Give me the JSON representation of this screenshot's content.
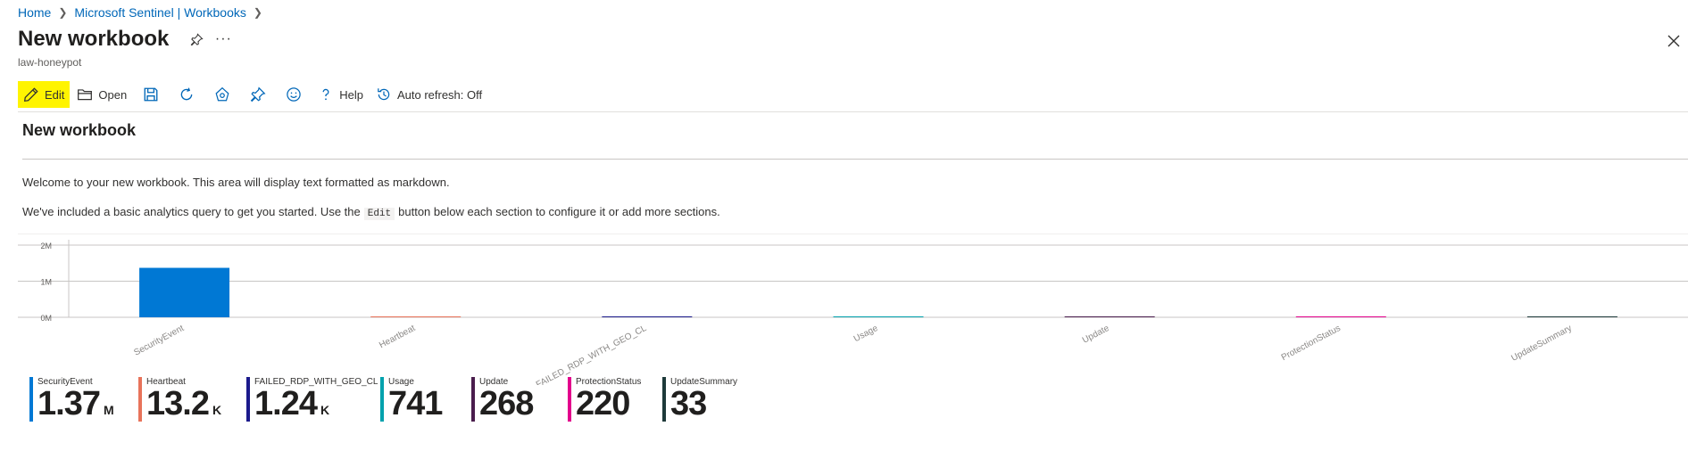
{
  "breadcrumb": {
    "home": "Home",
    "workbooks": "Microsoft Sentinel | Workbooks"
  },
  "header": {
    "title": "New workbook",
    "subtitle": "law-honeypot",
    "more": "···"
  },
  "toolbar": {
    "edit": "Edit",
    "open": "Open",
    "help": "Help",
    "auto_refresh": "Auto refresh: Off"
  },
  "workbook": {
    "title": "New workbook",
    "p1": "Welcome to your new workbook. This area will display text formatted as markdown.",
    "p2_pre": "We've included a basic analytics query to get you started. Use the",
    "p2_code": "Edit",
    "p2_post": "button below each section to configure it or add more sections."
  },
  "chart_data": {
    "type": "bar",
    "categories": [
      "SecurityEvent",
      "Heartbeat",
      "FAILED_RDP_WITH_GEO_CL",
      "Usage",
      "Update",
      "ProtectionStatus",
      "UpdateSummary"
    ],
    "values": [
      1370000,
      13200,
      1240,
      741,
      268,
      220,
      33
    ],
    "y_ticks": [
      "0M",
      "1M",
      "2M"
    ],
    "ylim": [
      0,
      2000000
    ],
    "colors": [
      "#0078d4",
      "#e8735a",
      "#1b1a8c",
      "#00a2ad",
      "#4a1d4d",
      "#e3008c",
      "#1e3a3a"
    ]
  },
  "tiles": [
    {
      "label": "SecurityEvent",
      "value": "1.37",
      "unit": "M",
      "color": "#0078d4"
    },
    {
      "label": "Heartbeat",
      "value": "13.2",
      "unit": "K",
      "color": "#e8735a"
    },
    {
      "label": "FAILED_RDP_WITH_GEO_CL",
      "value": "1.24",
      "unit": "K",
      "color": "#1b1a8c"
    },
    {
      "label": "Usage",
      "value": "741",
      "unit": "",
      "color": "#00a2ad"
    },
    {
      "label": "Update",
      "value": "268",
      "unit": "",
      "color": "#4a1d4d"
    },
    {
      "label": "ProtectionStatus",
      "value": "220",
      "unit": "",
      "color": "#e3008c"
    },
    {
      "label": "UpdateSummary",
      "value": "33",
      "unit": "",
      "color": "#1e3a3a"
    }
  ]
}
